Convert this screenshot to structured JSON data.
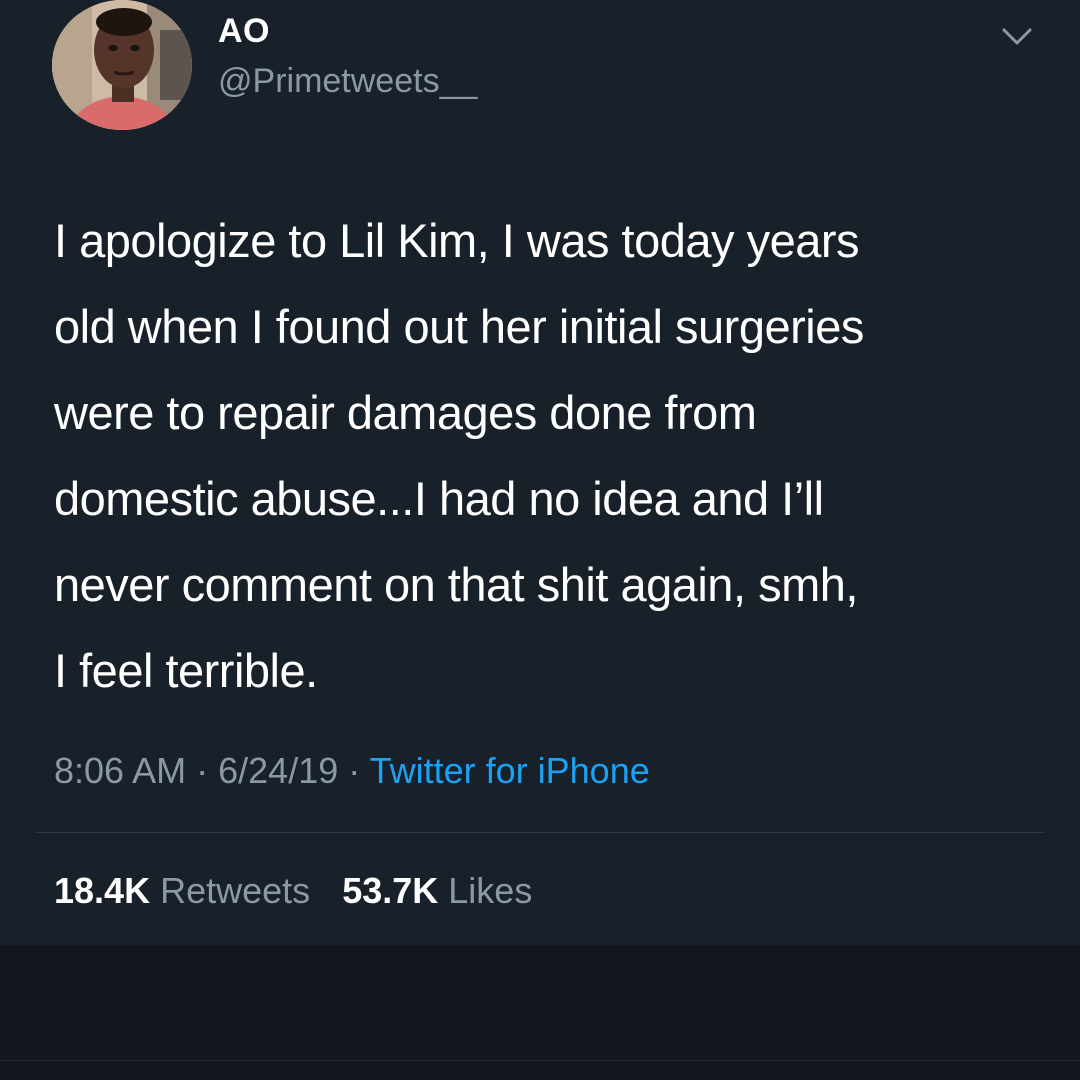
{
  "tweet": {
    "author": {
      "display_name": "AO",
      "handle": "@Primetweets__"
    },
    "text": "I apologize to Lil Kim, I was today years\nold when I found out her initial surgeries\nwere to repair damages done from\ndomestic abuse...I had no idea and I’ll\nnever comment on that shit again, smh,\nI feel terrible.",
    "time": "8:06 AM",
    "date": "6/24/19",
    "separator": "·",
    "source": "Twitter for iPhone",
    "retweets_count": "18.4K",
    "retweets_label": "Retweets",
    "likes_count": "53.7K",
    "likes_label": "Likes"
  },
  "icons": {
    "menu": "chevron-down-icon",
    "avatar": "avatar"
  },
  "colors": {
    "background": "#182029",
    "text": "#ffffff",
    "secondary_text": "#8b98a5",
    "link": "#1da1f2"
  }
}
